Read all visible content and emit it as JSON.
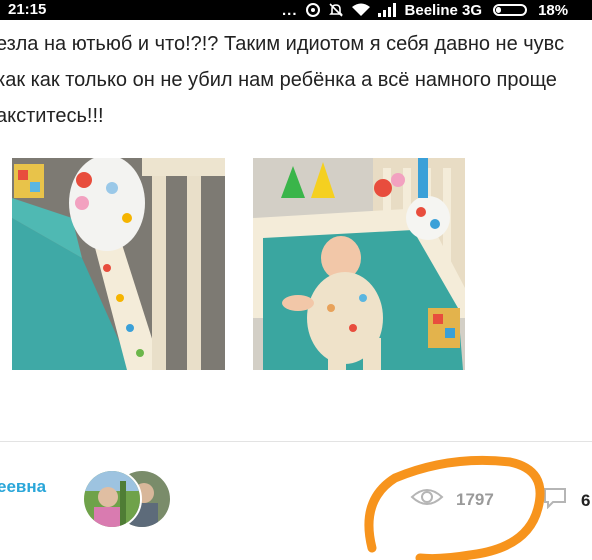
{
  "status_bar": {
    "time": "21:15",
    "overflow": "...",
    "carrier": "Beeline 3G",
    "battery_percent": "18%",
    "battery_level": 0.18,
    "icons": [
      "notification-dots",
      "circle-status-icon",
      "mute-icon",
      "wifi-icon",
      "signal-icon",
      "battery-icon"
    ]
  },
  "post": {
    "lines": [
      "езла на ютьюб и что!?!? Таким идиотом я себя давно не чувс",
      "как как только он не убил нам ребёнка а всё намного проще",
      "акститесь!!!"
    ]
  },
  "photos": [
    {
      "name": "crib-photo-toys"
    },
    {
      "name": "crib-photo-baby"
    }
  ],
  "footer": {
    "author_name": "еевна",
    "views_count": "1797",
    "comments_count": "6"
  },
  "colors": {
    "accent": "#2aa6d9",
    "annotation": "#f7941d",
    "muted": "#9a9a9a"
  }
}
